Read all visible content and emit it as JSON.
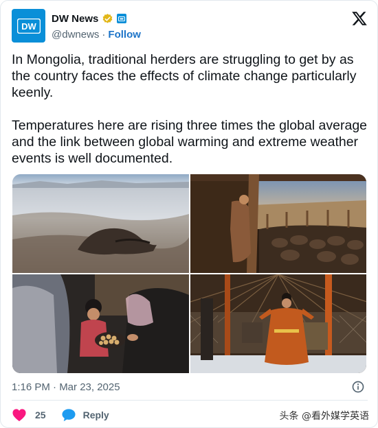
{
  "author": {
    "display_name": "DW News",
    "handle": "@dwnews",
    "separator": "·",
    "follow_label": "Follow",
    "avatar_text": "DW",
    "brand_color": "#0a8fd8"
  },
  "tweet": {
    "paragraphs": [
      "In Mongolia, traditional herders are struggling to get by as the country faces the effects of climate change particularly keenly.",
      "Temperatures here are rising three times the global average and the link between global warming and extreme weather events is well documented."
    ],
    "timestamp": "1:16 PM · Mar 23, 2025"
  },
  "actions": {
    "like_count": "25",
    "reply_label": "Reply"
  },
  "watermark": "头条 @看外媒学英语",
  "icons": {
    "verified": "verified-badge-icon",
    "affiliate": "dw-affiliate-icon",
    "x_logo": "x-logo-icon",
    "info": "info-icon",
    "heart": "heart-icon",
    "reply": "chat-bubble-icon"
  },
  "colors": {
    "link": "#1d74c8",
    "muted": "#536471",
    "heart": "#f91880",
    "reply": "#1d9bf0",
    "verified": "#e2b719"
  }
}
